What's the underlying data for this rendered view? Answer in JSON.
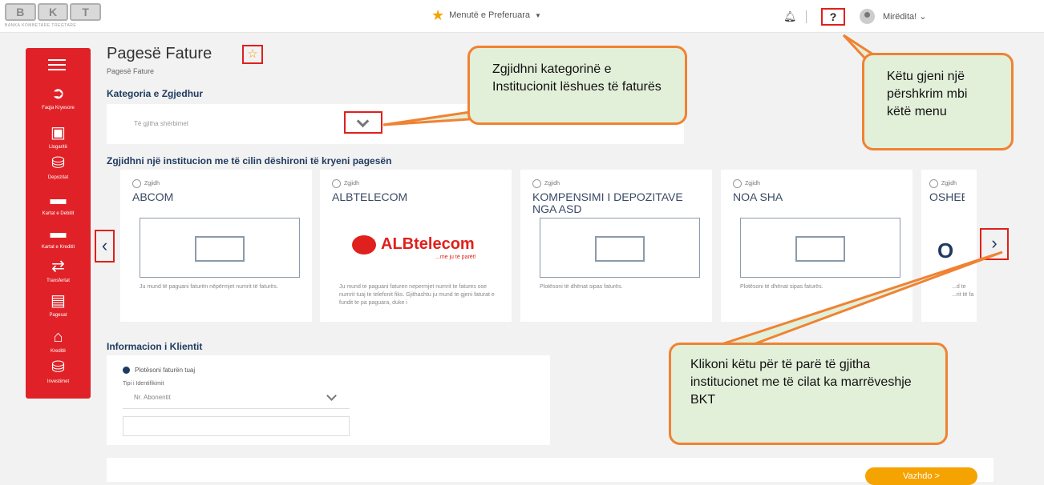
{
  "header": {
    "logo_text": "BKT",
    "logo_sub": "BANKA KOMBETARE TREGTARE",
    "favorites_label": "Menutë e Preferuara",
    "help_label": "?",
    "greeting": "Mirëdita!"
  },
  "sidebar": {
    "items": [
      {
        "label": "Faqja Kryesore",
        "icon": "home-icon"
      },
      {
        "label": "Llogaritë",
        "icon": "accounts-icon"
      },
      {
        "label": "Depozitat",
        "icon": "deposits-icon"
      },
      {
        "label": "Kartat e Debitit",
        "icon": "debit-card-icon"
      },
      {
        "label": "Kartat e Kreditit",
        "icon": "credit-card-icon"
      },
      {
        "label": "Transfertat",
        "icon": "transfer-icon"
      },
      {
        "label": "Pagesat",
        "icon": "payments-icon"
      },
      {
        "label": "Kreditë",
        "icon": "loans-icon"
      },
      {
        "label": "Investimet",
        "icon": "investments-icon"
      }
    ]
  },
  "page": {
    "title": "Pagesë Fature",
    "breadcrumb": "Pagesë Fature"
  },
  "category": {
    "heading": "Kategoria e Zgjedhur",
    "selected": "Të gjitha shërbimet"
  },
  "institutions": {
    "heading": "Zgjidhni një institucion me të cilin dëshironi të kryeni pagesën",
    "select_label": "Zgjidh",
    "cards": [
      {
        "name": "ABCOM",
        "description": "Ju mund të paguani faturën nëpërmjet numrit të faturës."
      },
      {
        "name": "ALBTELECOM",
        "logo_main": "ALBtelecom",
        "logo_tagline": "...me ju të parët!",
        "description": "Ju mund te paguani faturen nepermjet numrit te fatures ose numrit tuaj te telefonit fiks. Gjithashtu ju mund te gjeni faturat e fundit te pa paguara, duke i"
      },
      {
        "name": "KOMPENSIMI I DEPOZITAVE NGA ASD",
        "description": "Plotësoni të dhënat sipas faturës."
      },
      {
        "name": "NOA SHA",
        "description": "Plotësoni të dhënat sipas faturës."
      },
      {
        "name": "OSHEE",
        "description": "...d te ...rit të fa"
      }
    ]
  },
  "client": {
    "heading": "Informacion i Klientit",
    "option_label": "Plotësoni faturën tuaj",
    "id_type_label": "Tipi i Identifikimit",
    "id_type_value": "Nr. Abonentit",
    "input_value": ""
  },
  "actions": {
    "continue_label": "Vazhdo >"
  },
  "callouts": {
    "category": "Zgjidhni kategorinë e Institucionit lëshues të faturës",
    "help": "Këtu gjeni një përshkrim mbi këtë menu",
    "arrow": "Klikoni këtu për të parë të gjitha institucionet me të cilat ka marrëveshje BKT"
  },
  "colors": {
    "brand_red": "#e02228",
    "accent_orange": "#f5a300",
    "callout_border": "#f08232",
    "callout_fill": "#e2efd9",
    "heading_navy": "#1f3a5f"
  }
}
